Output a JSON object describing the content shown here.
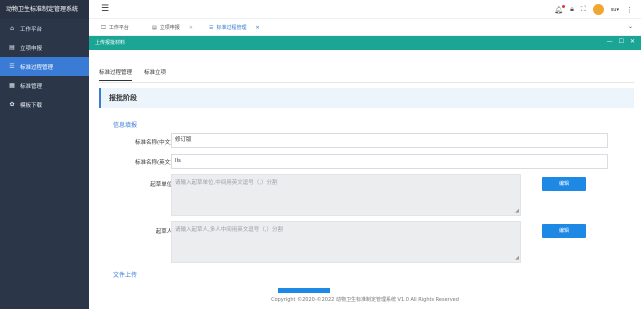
{
  "app": {
    "title": "动物卫生标准制定管理系统"
  },
  "sidebar": {
    "items": [
      {
        "label": "工作平台",
        "icon": "home-icon",
        "glyph": "⌂"
      },
      {
        "label": "立项申报",
        "icon": "file-icon",
        "glyph": "▤"
      },
      {
        "label": "标准过程管理",
        "icon": "list-icon",
        "glyph": "☰"
      },
      {
        "label": "标准管理",
        "icon": "table-icon",
        "glyph": "▦"
      },
      {
        "label": "模板下载",
        "icon": "gear-icon",
        "glyph": "✿"
      }
    ],
    "active_index": 2
  },
  "topbar": {
    "menu_icon": "hamburger-icon",
    "bell_icon": "bell-icon",
    "lock_icon": "lock-icon",
    "fullscreen_icon": "fullscreen-icon",
    "username": "su▾",
    "more_icon": "more-vertical-icon"
  },
  "tabs": [
    {
      "label": "工作平台",
      "icon": "monitor-icon",
      "closable": false
    },
    {
      "label": "立项申报",
      "icon": "file-icon",
      "closable": true
    },
    {
      "label": "标准过程管理",
      "icon": "list-icon",
      "closable": true
    }
  ],
  "panel": {
    "title": "上传报批材料",
    "controls": [
      "—",
      "☐",
      "✕"
    ]
  },
  "inner_tabs": [
    "标准过程管理",
    "标准立项"
  ],
  "stage_title": "报批阶段",
  "section_info": "信息填报",
  "form": {
    "name_cn_label": "标准名称(中文)",
    "name_cn_value": "修订版",
    "name_en_label": "标准名称(英文)",
    "name_en_value": "lls",
    "unit_label": "起草单位",
    "unit_placeholder": "请输入起草单位,中间用英文逗号（,）分割",
    "person_label": "起草人",
    "person_placeholder": "请输入起草人,多人中间用英文逗号（,）分割",
    "edit_label": "编辑",
    "required_mark": "*"
  },
  "section_upload": "文件上传",
  "footer": "Copyright ©2020-©2022 动物卫生标准制定管理系统 V1.0 All Rights Reserved",
  "colors": {
    "sidebar": "#2b3648",
    "active": "#3a7bd5",
    "panel_header": "#1aa595",
    "button": "#1e88e5"
  }
}
